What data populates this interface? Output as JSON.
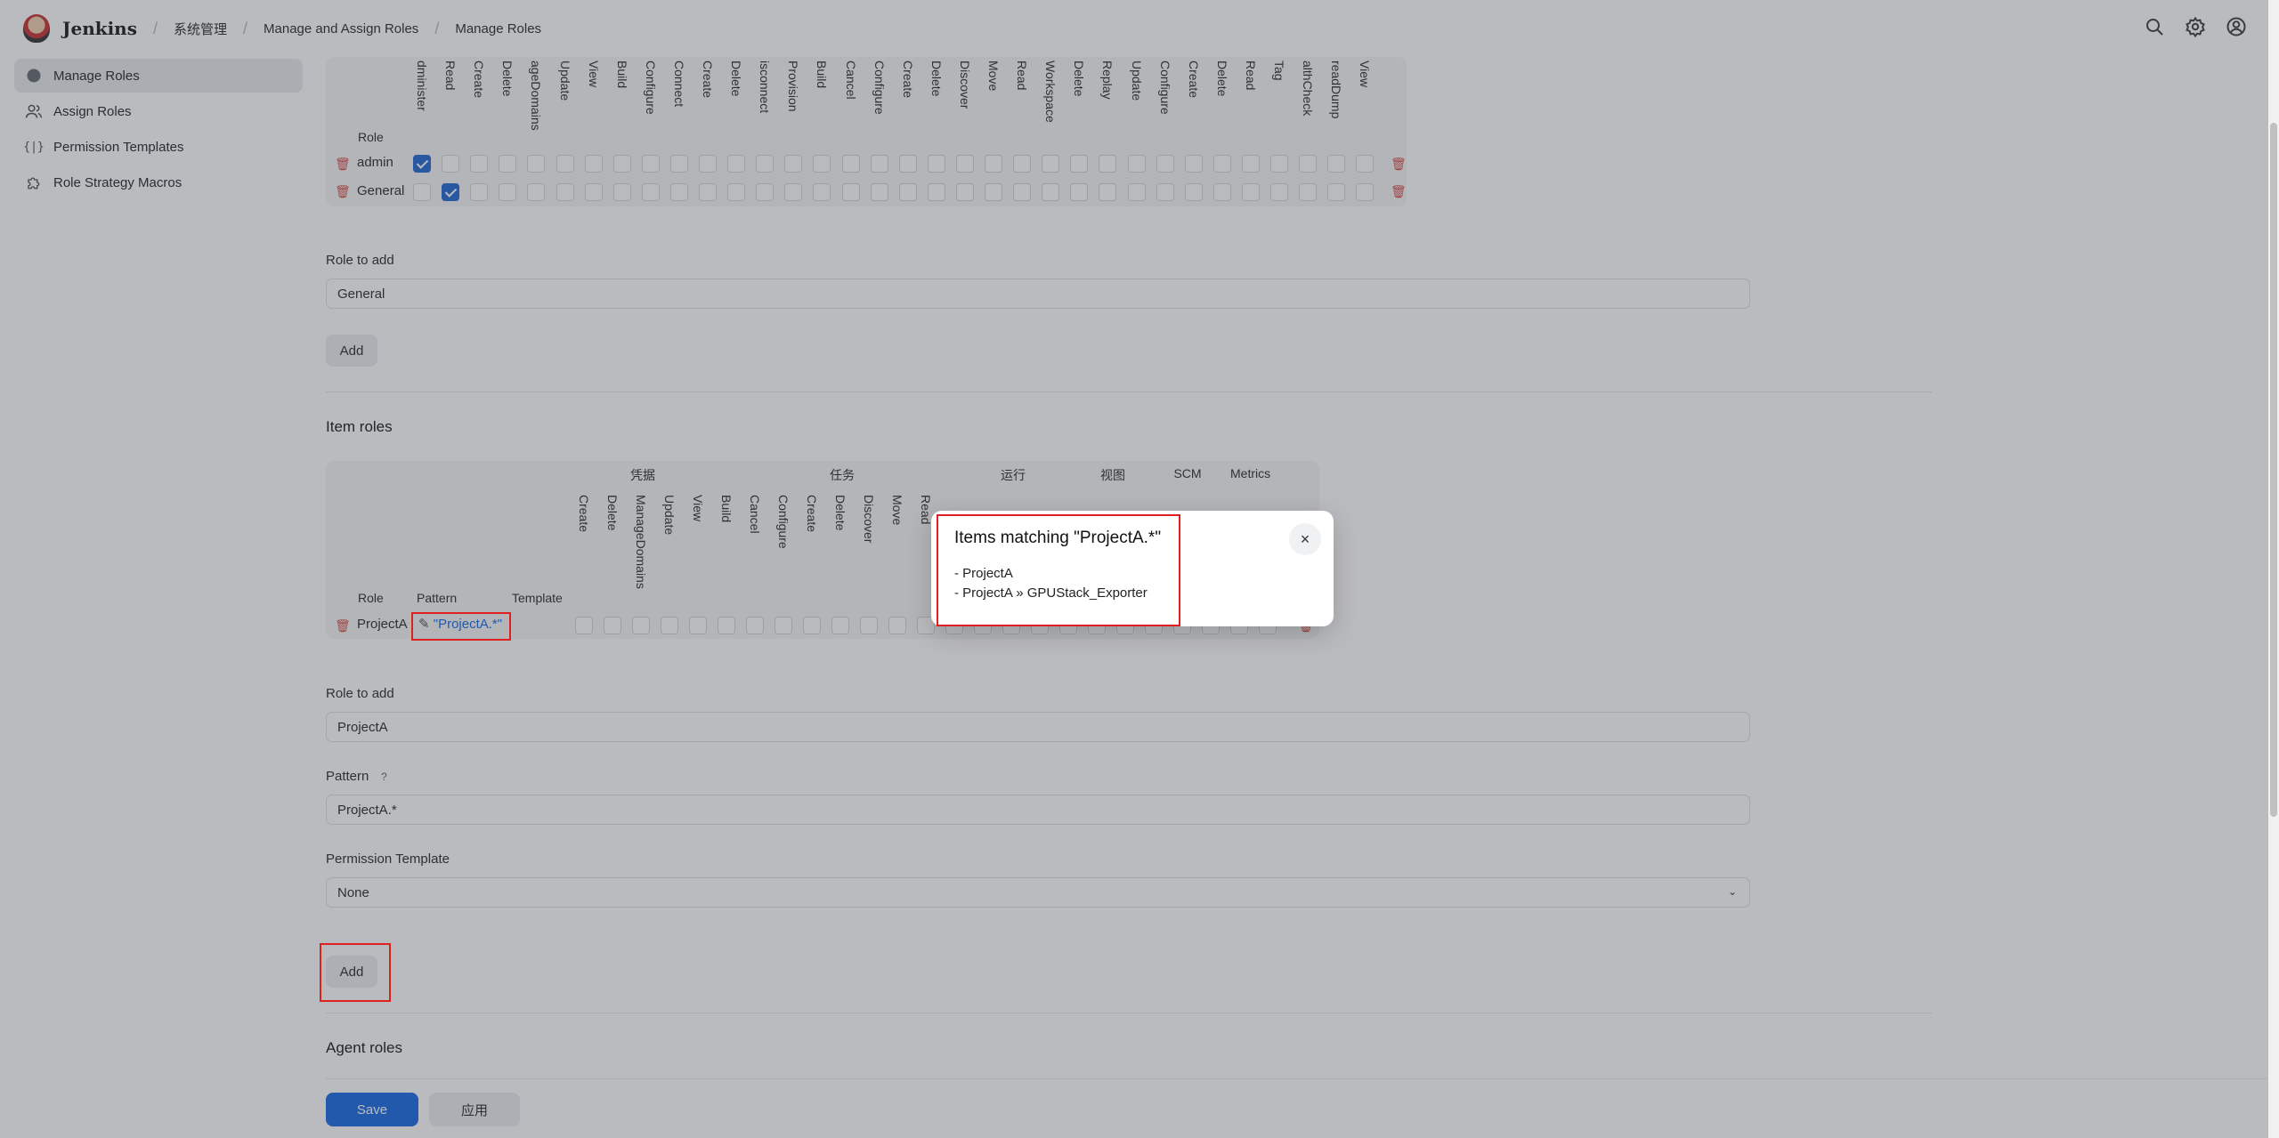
{
  "header": {
    "brand": "Jenkins",
    "breadcrumbs": [
      "系统管理",
      "Manage and Assign Roles",
      "Manage Roles"
    ],
    "icons": [
      "search-icon",
      "gear-icon",
      "user-icon"
    ]
  },
  "sidebar": {
    "items": [
      {
        "label": "Manage Roles",
        "icon": "lock-icon"
      },
      {
        "label": "Assign Roles",
        "icon": "users-icon"
      },
      {
        "label": "Permission Templates",
        "icon": "braces-icon"
      },
      {
        "label": "Role Strategy Macros",
        "icon": "puzzle-icon"
      }
    ]
  },
  "global_roles": {
    "columns": [
      "dminister",
      "Read",
      "Create",
      "Delete",
      "ageDomains",
      "Update",
      "View",
      "Build",
      "Configure",
      "Connect",
      "Create",
      "Delete",
      "isconnect",
      "Provision",
      "Build",
      "Cancel",
      "Configure",
      "Create",
      "Delete",
      "Discover",
      "Move",
      "Read",
      "Workspace",
      "Delete",
      "Replay",
      "Update",
      "Configure",
      "Create",
      "Delete",
      "Read",
      "Tag",
      "althCheck",
      "readDump",
      "View"
    ],
    "role_header": "Role",
    "rows": [
      {
        "name": "admin",
        "checked": [
          0
        ]
      },
      {
        "name": "General",
        "checked": [
          1
        ]
      }
    ]
  },
  "global_add": {
    "label": "Role to add",
    "value": "General",
    "button": "Add"
  },
  "item_roles": {
    "title": "Item roles",
    "groups": [
      "凭据",
      "任务",
      "运行",
      "视图",
      "SCM",
      "Metrics"
    ],
    "columns": [
      "Create",
      "Delete",
      "ManageDomains",
      "Update",
      "View",
      "Build",
      "Cancel",
      "Configure",
      "Create",
      "Delete",
      "Discover",
      "Move",
      "Read"
    ],
    "headers": {
      "role": "Role",
      "pattern": "Pattern",
      "template": "Template"
    },
    "row": {
      "name": "ProjectA",
      "pattern": "\"ProjectA.*\""
    }
  },
  "item_add": {
    "role_label": "Role to add",
    "role_value": "ProjectA",
    "pattern_label": "Pattern",
    "pattern_help": "?",
    "pattern_value": "ProjectA.*",
    "template_label": "Permission Template",
    "template_value": "None",
    "button": "Add"
  },
  "agent_roles": {
    "title": "Agent roles"
  },
  "footer": {
    "save": "Save",
    "apply": "应用"
  },
  "dialog": {
    "title": "Items matching \"ProjectA.*\"",
    "lines": [
      "- ProjectA",
      "- ProjectA » GPUStack_Exporter"
    ],
    "close": "×"
  },
  "colors": {
    "accent": "#1f6fe5",
    "danger": "#d9534f",
    "highlight": "#e02020"
  }
}
